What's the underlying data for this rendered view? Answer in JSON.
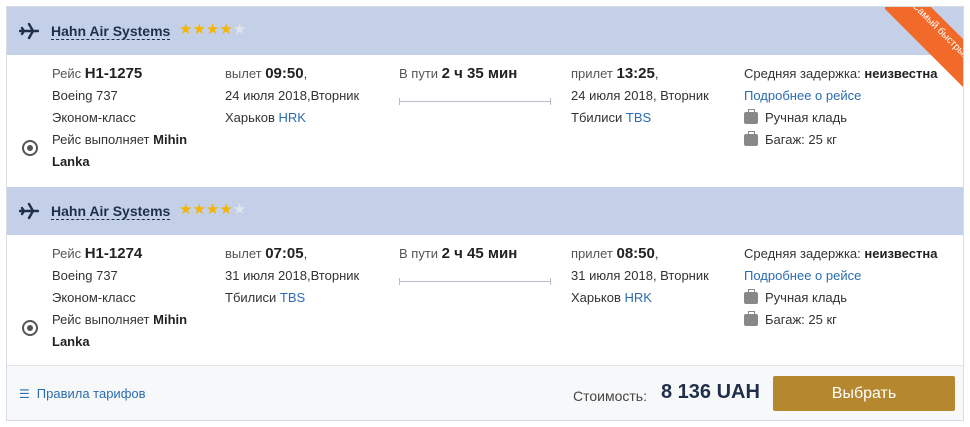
{
  "ribbon": "Самый быстрый",
  "colors": {
    "header_bg": "#c4d0e7",
    "accent_button": "#b5872f",
    "ribbon": "#f26a2a",
    "link": "#2a6cb0",
    "star": "#f4b400"
  },
  "segments": [
    {
      "airline": "Hahn Air Systems",
      "rating": 4,
      "rating_max": 5,
      "flight_label": "Рейс",
      "flight_no": "H1-1275",
      "aircraft": "Boeing 737",
      "cabin": "Эконом-класс",
      "operated_prefix": "Рейс выполняет",
      "operated_by_1": "Mihin",
      "operated_by_2": "Lanka",
      "dep_label": "вылет",
      "dep_time": "09:50",
      "dep_comma": ",",
      "dep_date": "24 июля 2018,Вторник",
      "dep_city": "Харьков",
      "dep_code": "HRK",
      "dur_label": "В пути",
      "dur_value": "2 ч 35 мин",
      "arr_label": "прилет",
      "arr_time": "13:25",
      "arr_comma": ",",
      "arr_date": "24 июля 2018, Вторник",
      "arr_city": "Тбилиси",
      "arr_code": "TBS",
      "delay_label": "Средняя задержка:",
      "delay_value": "неизвестна",
      "details_link": "Подробнее о рейсе",
      "hand_luggage": "Ручная кладь",
      "baggage": "Багаж: 25 кг"
    },
    {
      "airline": "Hahn Air Systems",
      "rating": 4,
      "rating_max": 5,
      "flight_label": "Рейс",
      "flight_no": "H1-1274",
      "aircraft": "Boeing 737",
      "cabin": "Эконом-класс",
      "operated_prefix": "Рейс выполняет",
      "operated_by_1": "Mihin",
      "operated_by_2": "Lanka",
      "dep_label": "вылет",
      "dep_time": "07:05",
      "dep_comma": ",",
      "dep_date": "31 июля 2018,Вторник",
      "dep_city": "Тбилиси",
      "dep_code": "TBS",
      "dur_label": "В пути",
      "dur_value": "2 ч 45 мин",
      "arr_label": "прилет",
      "arr_time": "08:50",
      "arr_comma": ",",
      "arr_date": "31 июля 2018, Вторник",
      "arr_city": "Харьков",
      "arr_code": "HRK",
      "delay_label": "Средняя задержка:",
      "delay_value": "неизвестна",
      "details_link": "Подробнее о рейсе",
      "hand_luggage": "Ручная кладь",
      "baggage": "Багаж: 25 кг"
    }
  ],
  "footer": {
    "rules_link": "Правила тарифов",
    "cost_label": "Стоимость:",
    "price": "8 136 UAH",
    "select_button": "Выбрать"
  }
}
